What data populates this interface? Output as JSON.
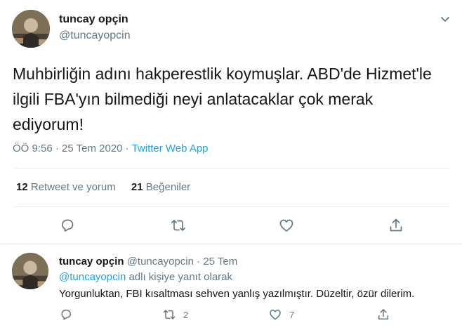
{
  "tweet": {
    "author_name": "tuncay opçin",
    "author_handle": "@tuncayopcin",
    "text": "Muhbirliğin adını hakperestlik koymuşlar. ABD'de Hizmet'le ilgili FBA'yın bilmediği neyi anlatacaklar çok merak ediyorum!",
    "time": "ÖÖ 9:56",
    "separator": " · ",
    "date": "25 Tem 2020",
    "source": "Twitter Web App",
    "retweet_count": "12",
    "retweet_label": "Retweet ve yorum",
    "like_count": "21",
    "like_label": "Beğeniler"
  },
  "reply": {
    "author_name": "tuncay opçin",
    "author_handle": "@tuncayopcin",
    "dot": " · ",
    "date": "25 Tem",
    "mention": "@tuncayopcin",
    "reply_label": "adlı kişiye yanıt olarak",
    "text": "Yorgunluktan, FBI kısaltması sehven yanlış yazılmıştır. Düzeltir, özür dilerim.",
    "retweet_count": "2",
    "like_count": "7"
  },
  "colors": {
    "link": "#1da1f2",
    "secondary": "#657786",
    "text": "#14171a",
    "border": "#e6ecf0"
  },
  "icons": [
    "chevron-down-icon",
    "reply-icon",
    "retweet-icon",
    "like-icon",
    "share-icon"
  ]
}
